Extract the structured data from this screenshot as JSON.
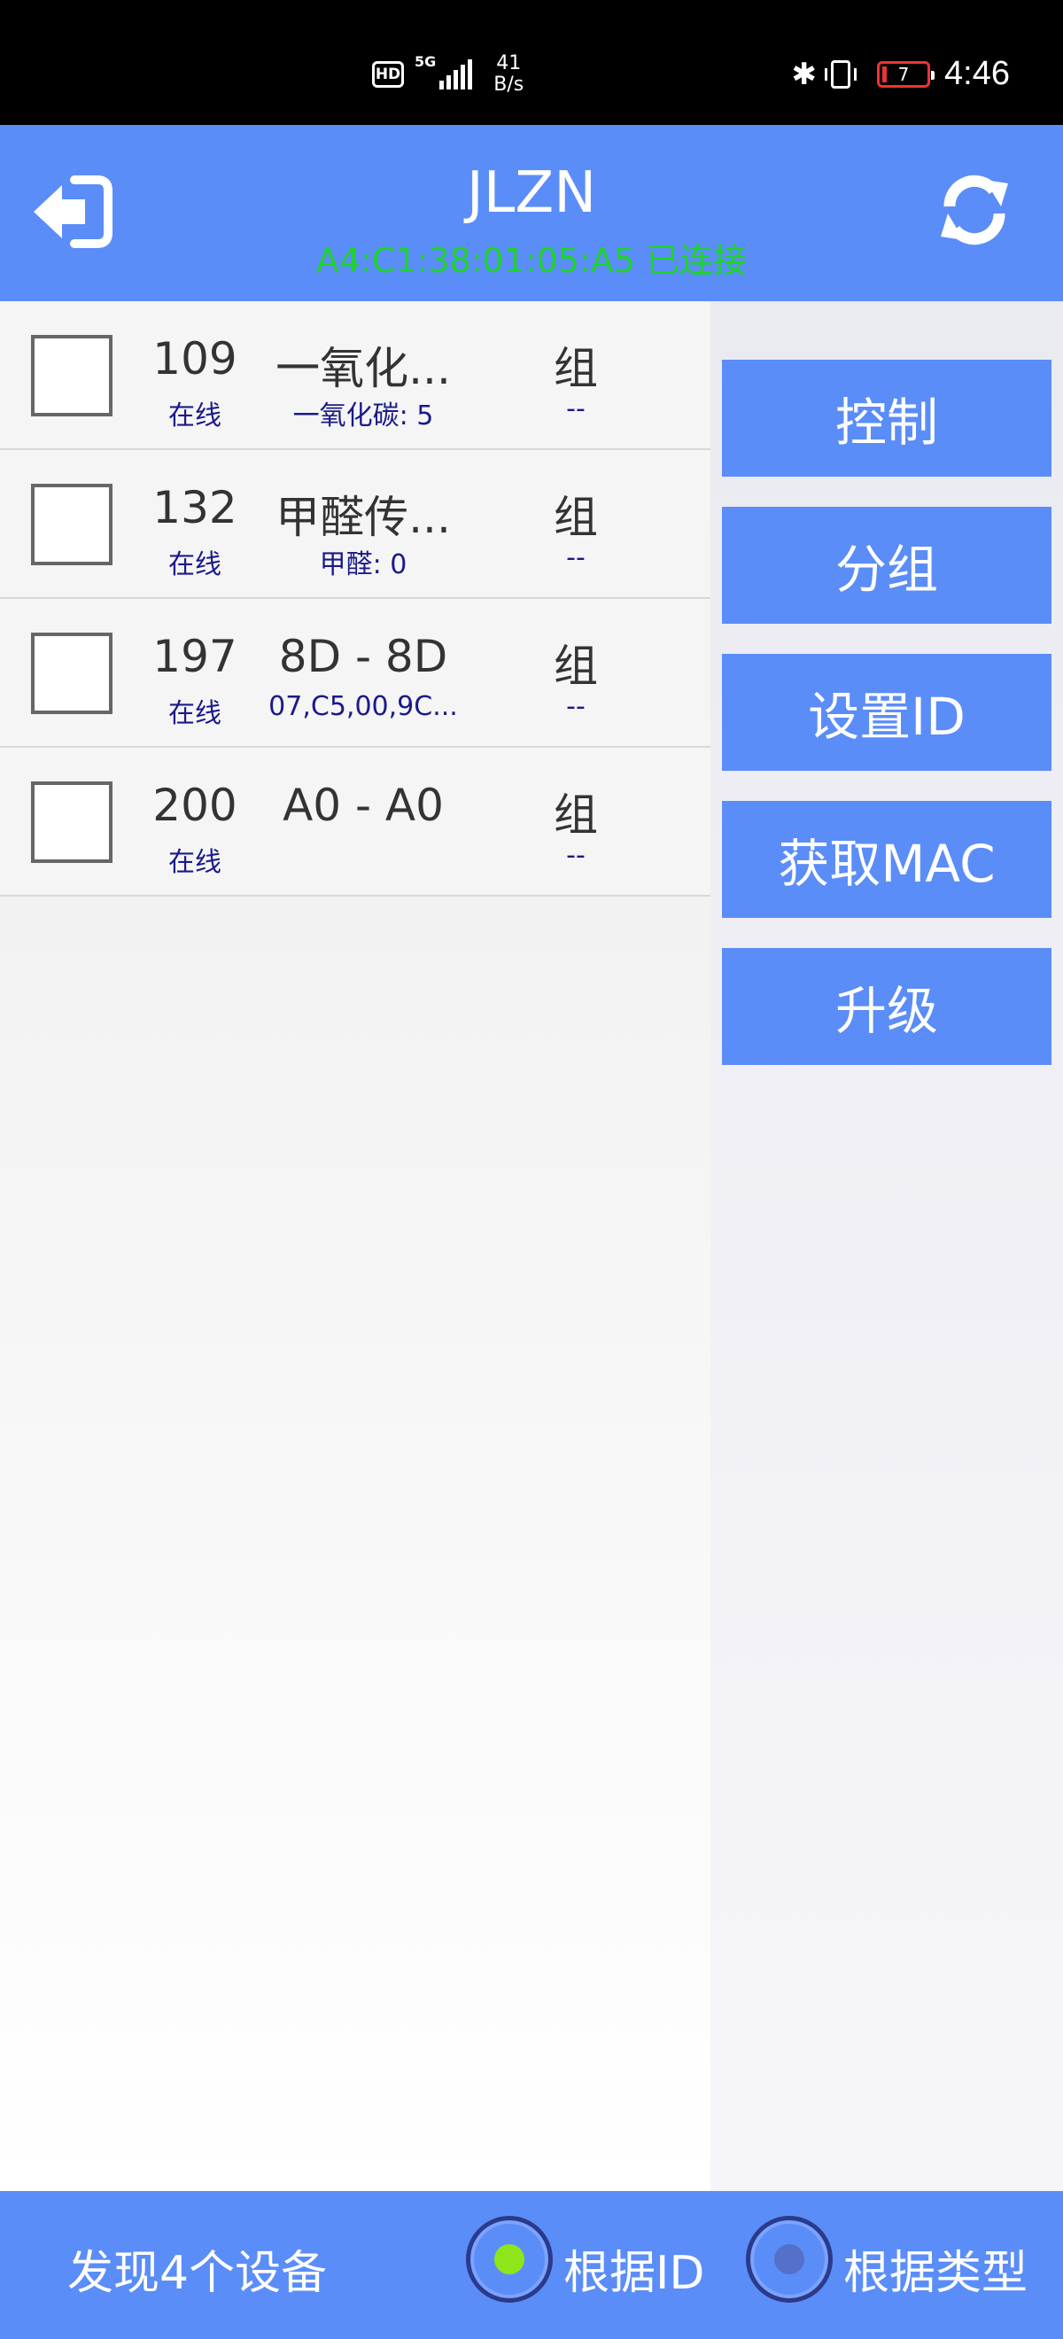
{
  "status_bar": {
    "hd": "HD",
    "network": "5G",
    "speed_value": "41",
    "speed_unit": "B/s",
    "battery": "7",
    "time": "4:46"
  },
  "header": {
    "title": "JLZN",
    "connection": "A4:C1:38:01:05:A5 已连接",
    "icons": {
      "back": "exit-icon",
      "refresh": "refresh-icon"
    }
  },
  "devices": [
    {
      "id": "109",
      "status": "在线",
      "name": "一氧化...",
      "value": "一氧化碳: 5",
      "group": "组",
      "group_value": "--"
    },
    {
      "id": "132",
      "status": "在线",
      "name": "甲醛传...",
      "value": "甲醛: 0",
      "group": "组",
      "group_value": "--"
    },
    {
      "id": "197",
      "status": "在线",
      "name": "8D - 8D",
      "value": "07,C5,00,9C...",
      "group": "组",
      "group_value": "--"
    },
    {
      "id": "200",
      "status": "在线",
      "name": "A0 - A0",
      "value": "",
      "group": "组",
      "group_value": "--"
    }
  ],
  "actions": {
    "control": "控制",
    "group": "分组",
    "set_id": "设置ID",
    "get_mac": "获取MAC",
    "upgrade": "升级"
  },
  "footer": {
    "found": "发现4个设备",
    "sort_by_id": "根据ID",
    "sort_by_type": "根据类型",
    "selected": "sort_by_id"
  },
  "colors": {
    "accent": "#5b8df8",
    "connected": "#1ed32a",
    "radio_on": "#8ee61a",
    "radio_off": "#5470c8",
    "subtext": "#1a1a8a"
  }
}
